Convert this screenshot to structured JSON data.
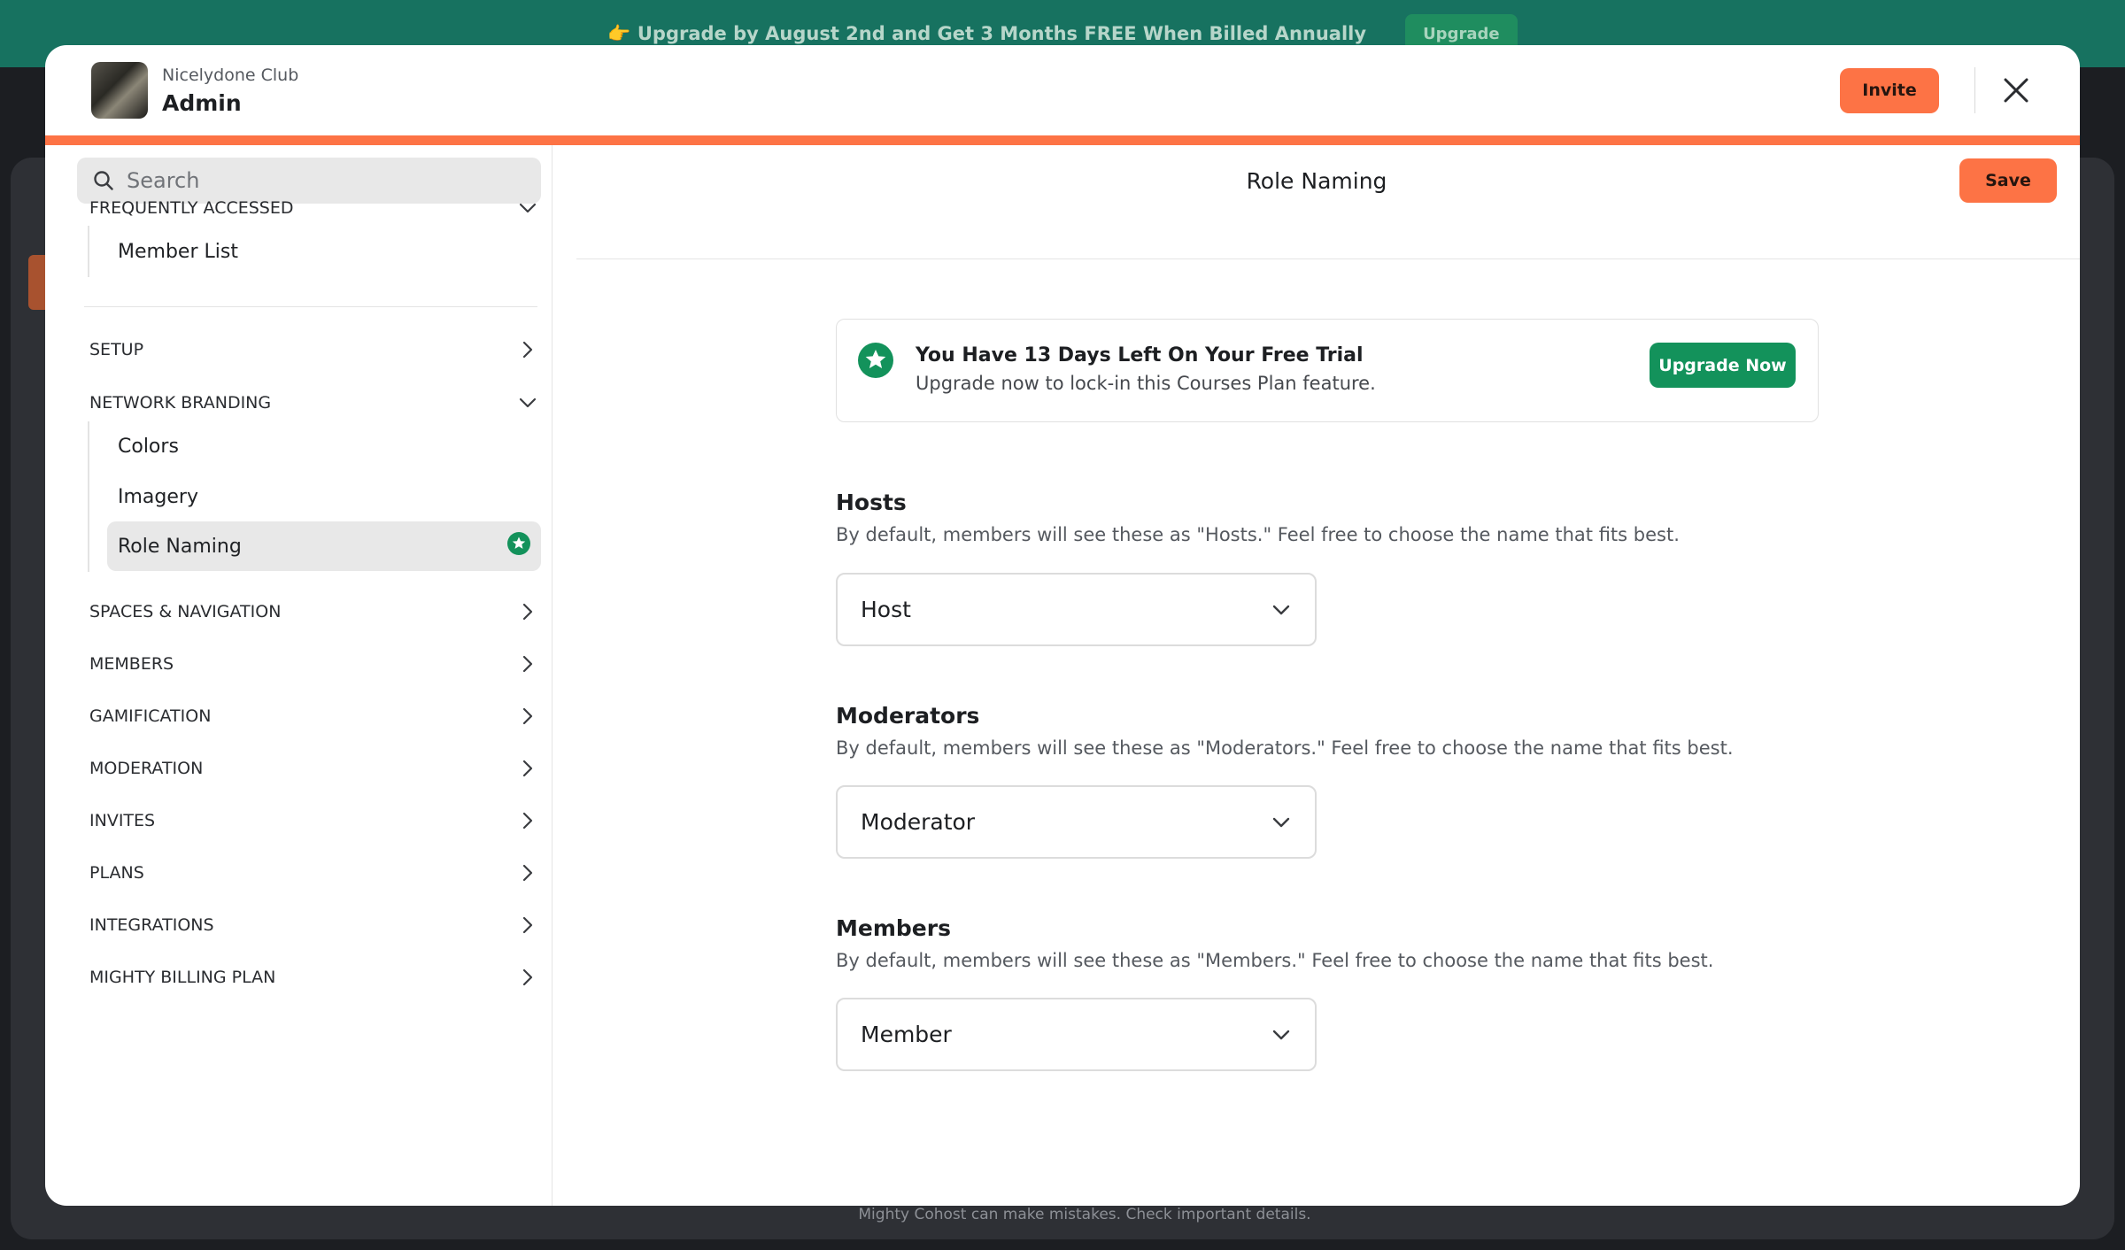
{
  "banner": {
    "text": "👉 Upgrade by August 2nd and Get 3 Months FREE When Billed Annually",
    "button": "Upgrade"
  },
  "background": {
    "footer": "Mighty Cohost can make mistakes. Check important details."
  },
  "header": {
    "club_name": "Nicelydone Club",
    "role": "Admin",
    "invite_label": "Invite"
  },
  "sidebar": {
    "search_placeholder": "Search",
    "sections": [
      {
        "label": "FREQUENTLY ACCESSED",
        "expanded": true,
        "items": [
          "Member List"
        ]
      },
      {
        "label": "SETUP",
        "expanded": false
      },
      {
        "label": "NETWORK BRANDING",
        "expanded": true,
        "items": [
          "Colors",
          "Imagery",
          "Role Naming"
        ]
      },
      {
        "label": "SPACES & NAVIGATION",
        "expanded": false
      },
      {
        "label": "MEMBERS",
        "expanded": false
      },
      {
        "label": "GAMIFICATION",
        "expanded": false
      },
      {
        "label": "MODERATION",
        "expanded": false
      },
      {
        "label": "INVITES",
        "expanded": false
      },
      {
        "label": "PLANS",
        "expanded": false
      },
      {
        "label": "INTEGRATIONS",
        "expanded": false
      },
      {
        "label": "MIGHTY BILLING PLAN",
        "expanded": false
      }
    ],
    "active_item": "Role Naming"
  },
  "main": {
    "title": "Role Naming",
    "save_label": "Save",
    "trial": {
      "title": "You Have 13 Days Left On Your Free Trial",
      "subtitle": "Upgrade now to lock-in this Courses Plan feature.",
      "button": "Upgrade Now"
    },
    "roles": [
      {
        "title": "Hosts",
        "description": "By default, members will see these as \"Hosts.\" Feel free to choose the name that fits best.",
        "value": "Host"
      },
      {
        "title": "Moderators",
        "description": "By default, members will see these as \"Moderators.\" Feel free to choose the name that fits best.",
        "value": "Moderator"
      },
      {
        "title": "Members",
        "description": "By default, members will see these as \"Members.\" Feel free to choose the name that fits best.",
        "value": "Member"
      }
    ]
  },
  "colors": {
    "accent": "#fd7345",
    "success": "#13925b",
    "banner": "#177260"
  }
}
